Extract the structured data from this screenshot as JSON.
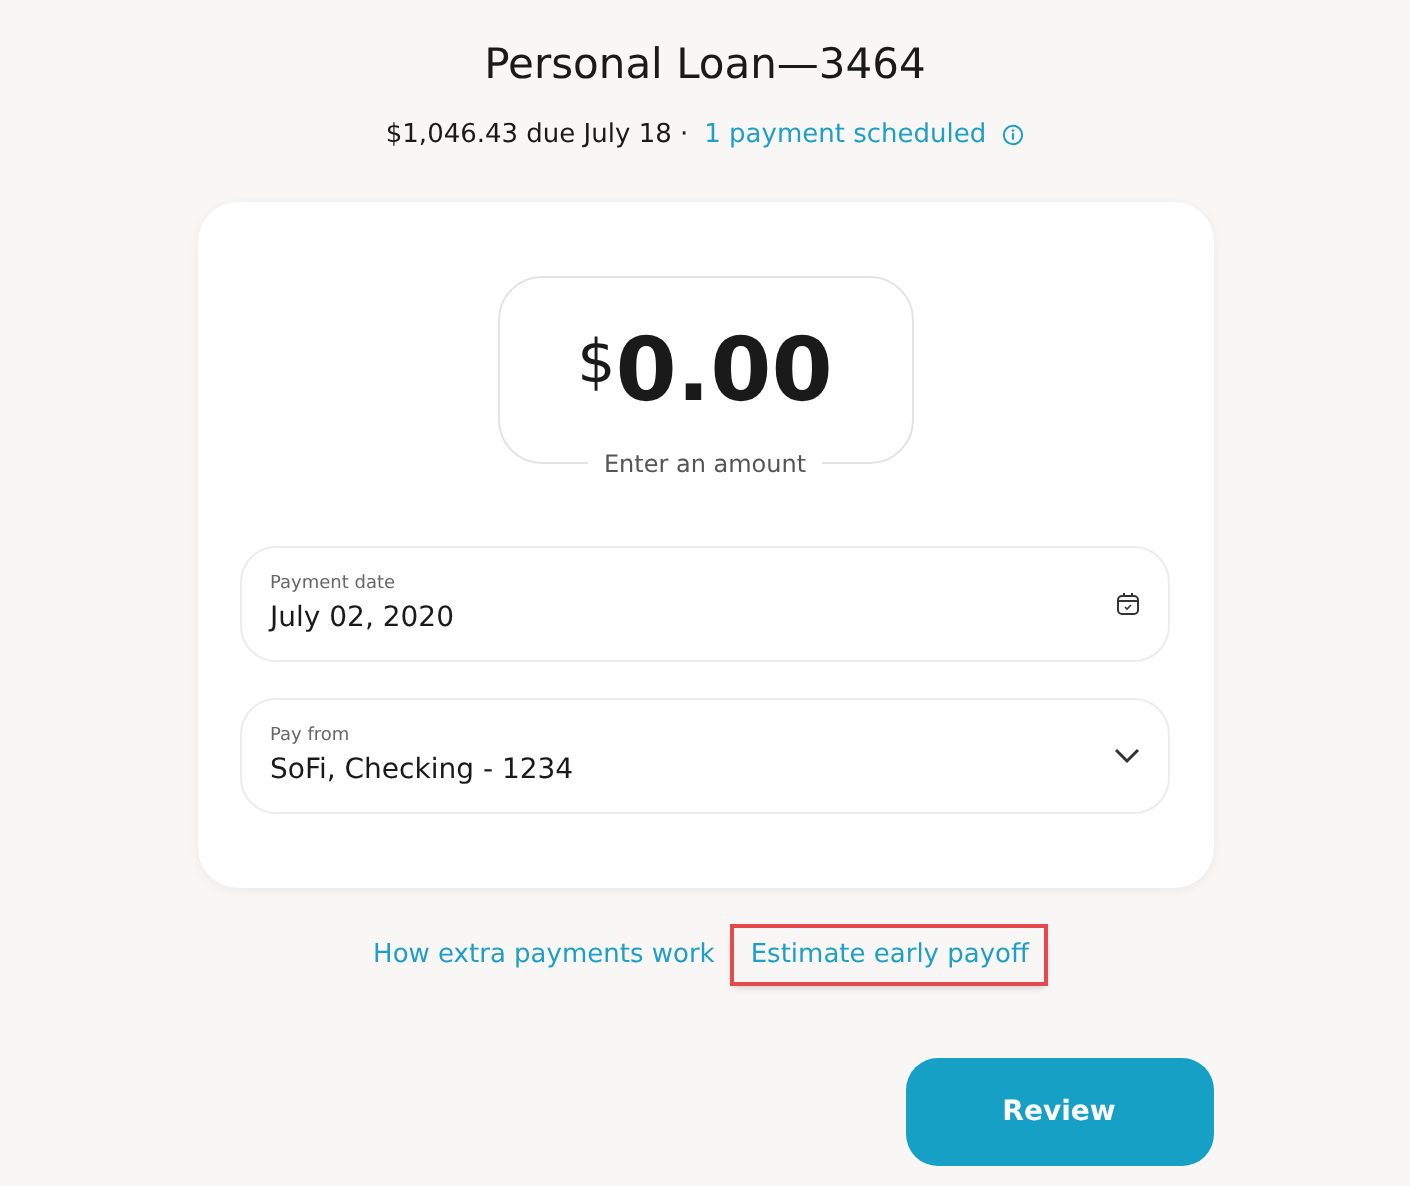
{
  "title": "Personal Loan—3464",
  "due": {
    "text": "$1,046.43 due July 18 ·",
    "link": "1 payment scheduled"
  },
  "amount": {
    "currency": "$",
    "value": "0.00",
    "label": "Enter an amount"
  },
  "fields": [
    {
      "kind": "date",
      "label": "Payment date",
      "value": "July 02, 2020"
    },
    {
      "kind": "select",
      "label": "Pay from",
      "value": "SoFi, Checking - 1234"
    }
  ],
  "links": [
    {
      "label": "How extra payments work",
      "highlighted": false
    },
    {
      "label": "Estimate early payoff",
      "highlighted": true
    }
  ],
  "button": "Review"
}
